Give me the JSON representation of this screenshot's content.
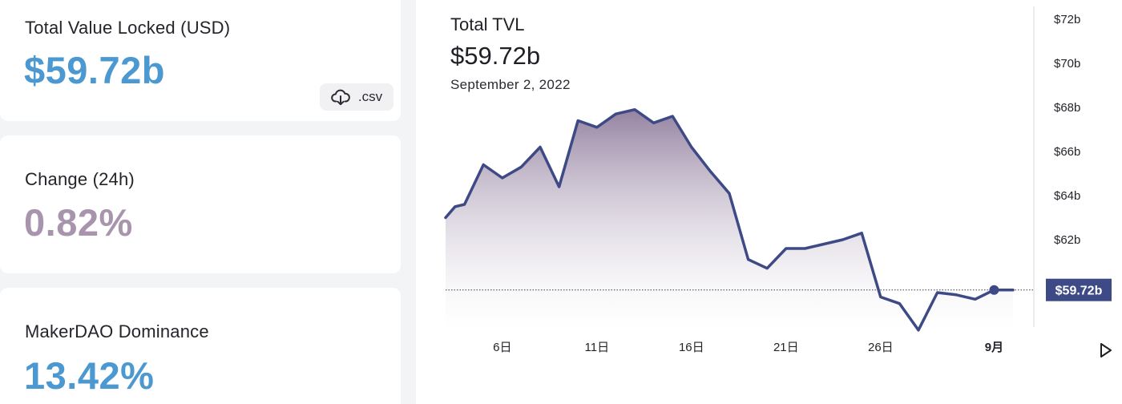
{
  "stats": {
    "tvl_label": "Total Value Locked (USD)",
    "tvl_value": "$59.72b",
    "change_label": "Change (24h)",
    "change_value": "0.82%",
    "dominance_label": "MakerDAO Dominance",
    "dominance_value": "13.42%"
  },
  "csv_button": {
    "icon": "cloud-download-icon",
    "label": ".csv"
  },
  "chart_header": {
    "title": "Total TVL",
    "value": "$59.72b",
    "date": "September 2, 2022"
  },
  "colors": {
    "line": "#3e4a86",
    "area_top": "#8f7c9c",
    "area_bottom": "#ffffff",
    "primary_stat": "#4c98d0",
    "change_stat": "#a895ad",
    "marker_label_bg": "#3e4a86"
  },
  "chart_data": {
    "type": "area",
    "title": "Total TVL",
    "ylim": [
      58,
      72
    ],
    "y_ticks": [
      "$62b",
      "$64b",
      "$66b",
      "$68b",
      "$70b",
      "$72b"
    ],
    "y_tick_values": [
      62,
      64,
      66,
      68,
      70,
      72
    ],
    "x_ticks": [
      "6日",
      "11日",
      "16日",
      "21日",
      "26日",
      "9月"
    ],
    "x_tick_days": [
      6,
      11,
      16,
      21,
      26,
      32
    ],
    "x_range": [
      3,
      34.1
    ],
    "grid": false,
    "current_value_label": "$59.72b",
    "current_value": 59.72,
    "series": [
      {
        "x": [
          3,
          3.5,
          4,
          5,
          6,
          7,
          8,
          9,
          10,
          11,
          12,
          13,
          14,
          15,
          16,
          17,
          18,
          19,
          20,
          21,
          22,
          23,
          24,
          25,
          26,
          27,
          28,
          29,
          30,
          31,
          32,
          33
        ],
        "values": [
          63.0,
          63.5,
          63.6,
          65.4,
          64.8,
          65.3,
          66.2,
          64.4,
          67.4,
          67.1,
          67.7,
          67.9,
          67.3,
          67.6,
          66.2,
          65.1,
          64.1,
          61.1,
          60.7,
          61.6,
          61.6,
          61.8,
          62.0,
          62.3,
          59.4,
          59.1,
          57.9,
          59.6,
          59.5,
          59.3,
          59.72,
          59.72
        ]
      }
    ]
  }
}
